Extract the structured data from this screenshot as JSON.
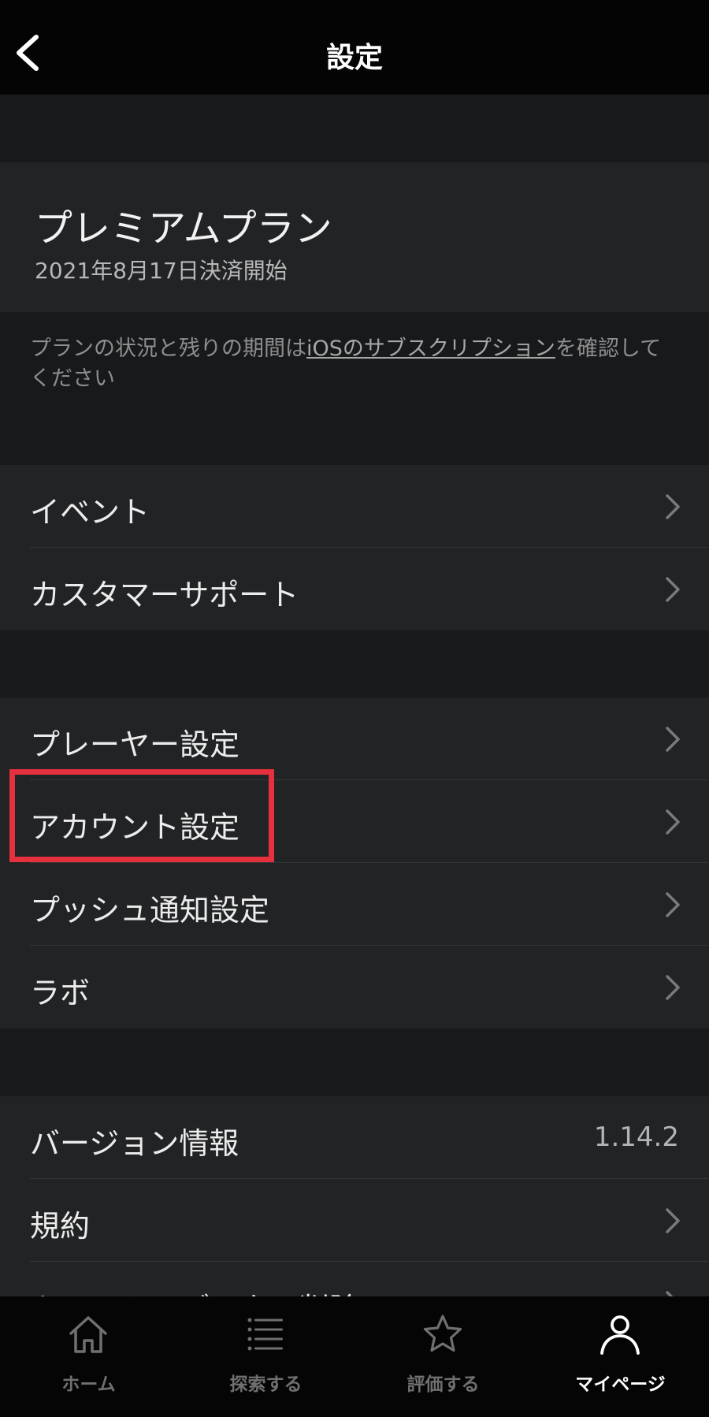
{
  "header": {
    "title": "設定"
  },
  "plan": {
    "name": "プレミアムプラン",
    "start_date": "2021年8月17日決済開始"
  },
  "notice": {
    "prefix": "プランの状況と残りの期間は",
    "link": "iOSのサブスクリプション",
    "suffix": "を確認してください"
  },
  "group1": [
    {
      "label": "イベント"
    },
    {
      "label": "カスタマーサポート"
    }
  ],
  "group2": [
    {
      "label": "プレーヤー設定"
    },
    {
      "label": "アカウント設定"
    },
    {
      "label": "プッシュ通知設定"
    },
    {
      "label": "ラボ"
    }
  ],
  "group3": [
    {
      "label": "バージョン情報",
      "value": "1.14.2"
    },
    {
      "label": "規約"
    },
    {
      "label": "キャッシュデータの削除"
    }
  ],
  "tabs": [
    {
      "label": "ホーム",
      "icon": "home-icon"
    },
    {
      "label": "探索する",
      "icon": "list-icon"
    },
    {
      "label": "評価する",
      "icon": "star-icon"
    },
    {
      "label": "マイページ",
      "icon": "person-icon",
      "active": true
    }
  ],
  "colors": {
    "highlight": "#e5303d",
    "background": "#18191b",
    "card": "#222325"
  }
}
